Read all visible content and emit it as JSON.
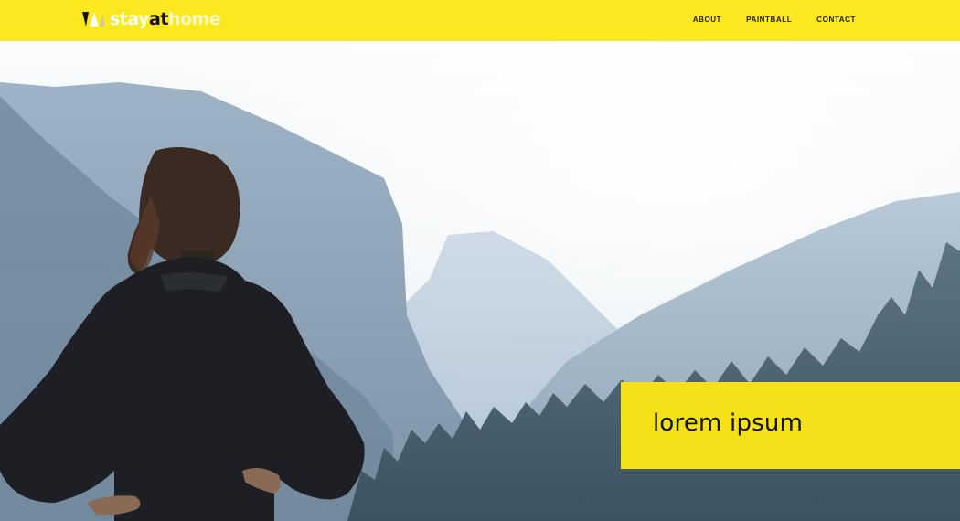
{
  "brand": {
    "word1": "stay",
    "word2": "at",
    "word3": "home"
  },
  "nav": {
    "items": [
      {
        "label": "ABOUT"
      },
      {
        "label": "PAINTBALL"
      },
      {
        "label": "CONTACT"
      }
    ]
  },
  "hero": {
    "image_subject": "woman-overlooking-misty-mountains",
    "callout_text": "lorem ipsum"
  },
  "colors": {
    "accent": "#fce81e",
    "callout": "#f4e118",
    "text": "#111111"
  }
}
